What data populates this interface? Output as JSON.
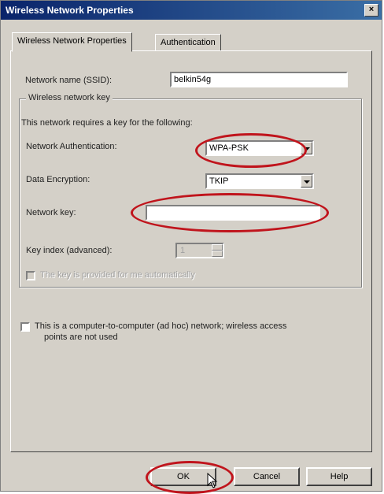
{
  "window": {
    "title": "Wireless Network Properties",
    "close_glyph": "×"
  },
  "tabs": [
    {
      "label": "Wireless Network Properties",
      "active": true
    },
    {
      "label": "Authentication",
      "active": false
    }
  ],
  "ssid": {
    "label": "Network name (SSID):",
    "value": "belkin54g"
  },
  "key_group": {
    "legend": "Wireless network key",
    "description": "This network requires a key for the following:",
    "auth_label": "Network Authentication:",
    "auth_value": "WPA-PSK",
    "encryption_label": "Data Encryption:",
    "encryption_value": "TKIP",
    "key_label": "Network key:",
    "key_value": "",
    "key_index_label": "Key index (advanced):",
    "key_index_value": "1",
    "auto_key_label": "The key is provided for me automatically",
    "auto_key_checked": false
  },
  "adhoc": {
    "label_line1": "This is a computer-to-computer (ad hoc) network; wireless access",
    "label_line2": "points are not used",
    "checked": false
  },
  "buttons": {
    "ok": "OK",
    "cancel": "Cancel",
    "help": "Help"
  },
  "annotation_color": "#c0141c"
}
